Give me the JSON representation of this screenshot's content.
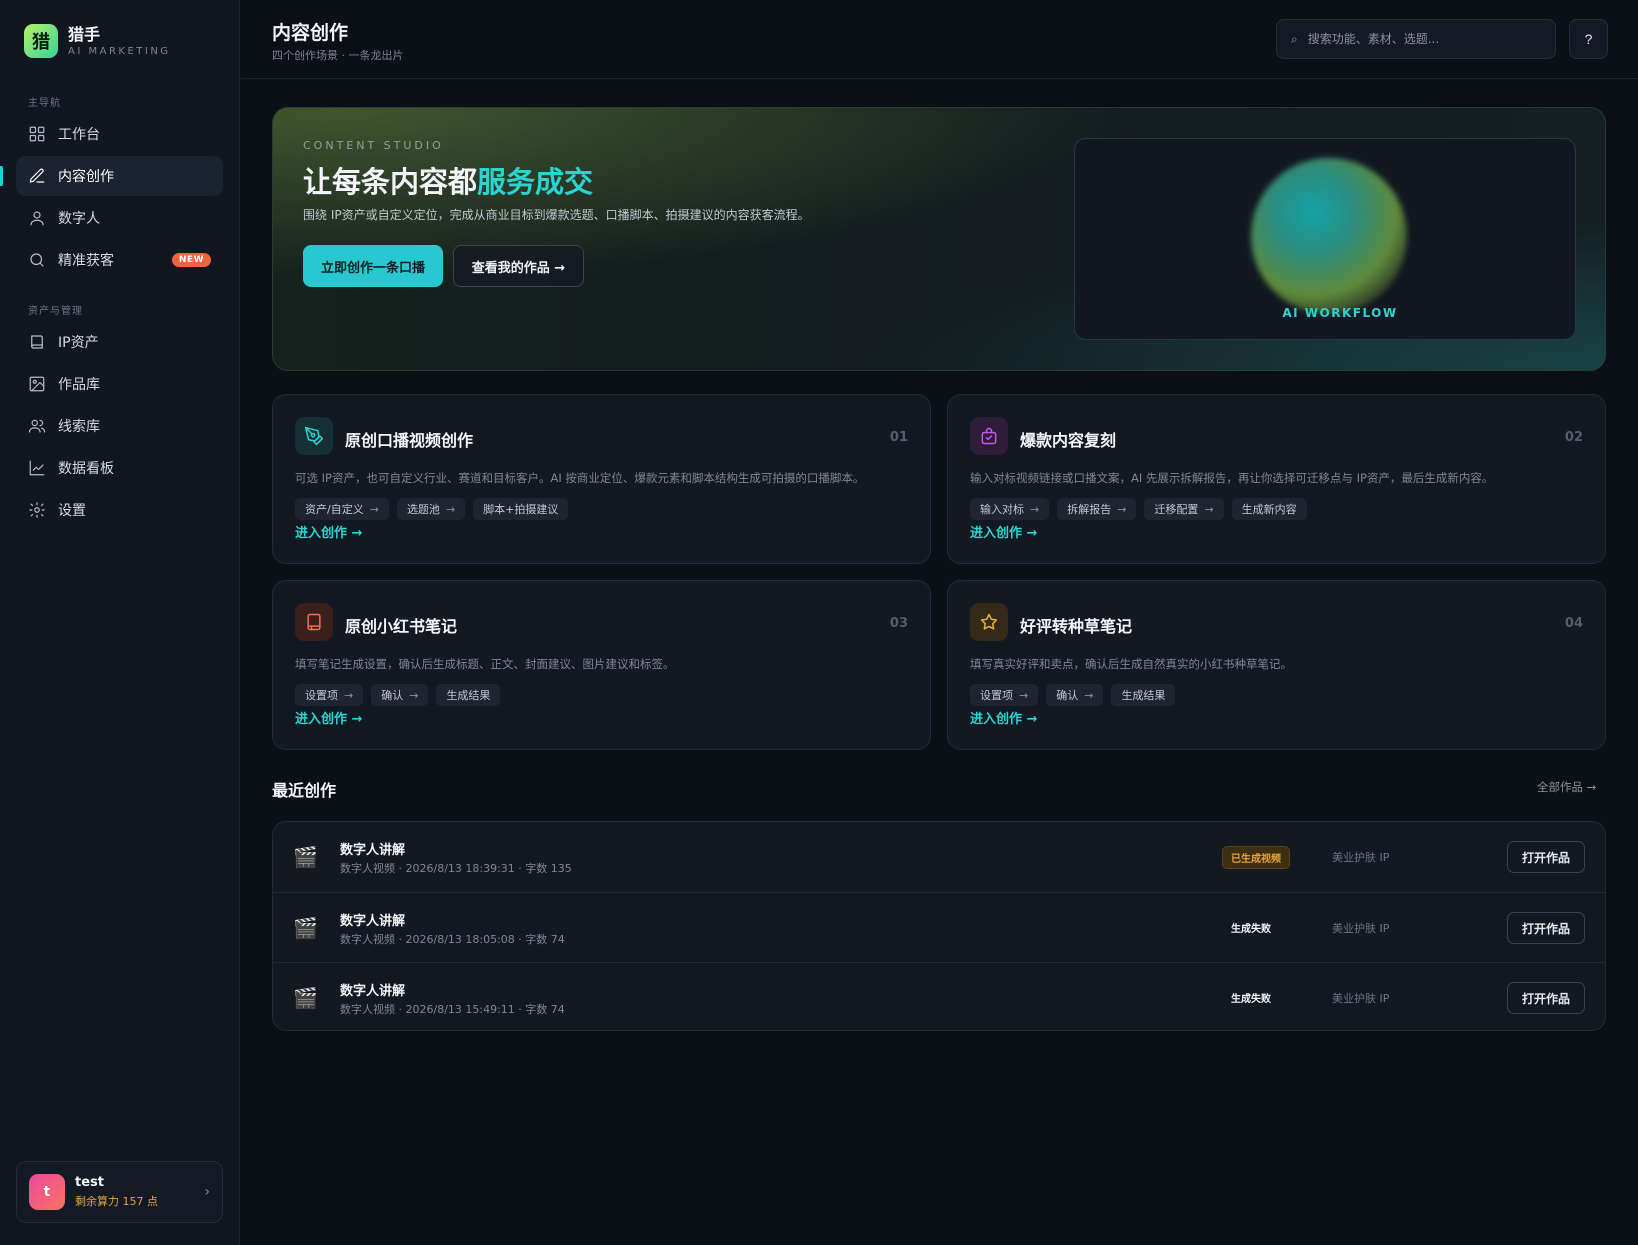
{
  "brand": {
    "logo_char": "猎",
    "name": "猎手",
    "subtitle": "AI MARKETING"
  },
  "sidebar": {
    "section_main": "主导航",
    "section_assets": "资产与管理",
    "items": [
      {
        "label": "工作台",
        "icon": "grid-icon"
      },
      {
        "label": "内容创作",
        "icon": "pencil-icon",
        "active": true
      },
      {
        "label": "数字人",
        "icon": "user-icon"
      },
      {
        "label": "精准获客",
        "icon": "search-icon",
        "badge": "NEW"
      },
      {
        "label": "IP资产",
        "icon": "book-icon"
      },
      {
        "label": "作品库",
        "icon": "image-icon"
      },
      {
        "label": "线索库",
        "icon": "users-icon"
      },
      {
        "label": "数据看板",
        "icon": "chart-icon"
      },
      {
        "label": "设置",
        "icon": "gear-icon"
      }
    ],
    "user": {
      "avatar": "t",
      "name": "test",
      "points": "剩余算力 157 点"
    }
  },
  "header": {
    "title": "内容创作",
    "subtitle": "四个创作场景 · 一条龙出片",
    "search_placeholder": "搜索功能、素材、选题...",
    "help": "?"
  },
  "hero": {
    "eyebrow": "CONTENT STUDIO",
    "title_prefix": "让每条内容都",
    "title_accent": "服务成交",
    "description": "围绕 IP资产或自定义定位，完成从商业目标到爆款选题、口播脚本、拍摄建议的内容获客流程。",
    "primary_button": "立即创作一条口播",
    "secondary_button": "查看我的作品 →",
    "visual_label": "AI WORKFLOW"
  },
  "cards": [
    {
      "title": "原创口播视频创作",
      "num": "01",
      "desc": "可选 IP资产，也可自定义行业、赛道和目标客户。AI 按商业定位、爆款元素和脚本结构生成可拍摄的口播脚本。",
      "chips": [
        "资产/自定义",
        "选题池",
        "脚本+拍摄建议"
      ],
      "link": "进入创作 →",
      "icon": "pen-tool-icon",
      "color": "#2bd4d0"
    },
    {
      "title": "爆款内容复刻",
      "num": "02",
      "desc": "输入对标视频链接或口播文案，AI 先展示拆解报告，再让你选择可迁移点与 IP资产，最后生成新内容。",
      "chips": [
        "输入对标",
        "拆解报告",
        "迁移配置",
        "生成新内容"
      ],
      "link": "进入创作 →",
      "icon": "shopping-bag-icon",
      "color": "#c15ae6"
    },
    {
      "title": "原创小红书笔记",
      "num": "03",
      "desc": "填写笔记生成设置，确认后生成标题、正文、封面建议、图片建议和标签。",
      "chips": [
        "设置项",
        "确认",
        "生成结果"
      ],
      "link": "进入创作 →",
      "icon": "notebook-icon",
      "color": "#f07050"
    },
    {
      "title": "好评转种草笔记",
      "num": "04",
      "desc": "填写真实好评和卖点，确认后生成自然真实的小红书种草笔记。",
      "chips": [
        "设置项",
        "确认",
        "生成结果"
      ],
      "link": "进入创作 →",
      "icon": "star-icon",
      "color": "#e8b03a"
    }
  ],
  "recent": {
    "title": "最近创作",
    "view_all": "全部作品 →",
    "rows": [
      {
        "icon": "🎬",
        "title": "数字人讲解",
        "meta": "数字人视频 · 2026/8/13 18:39:31 · 字数 135",
        "status": "已生成视频",
        "status_type": "ok",
        "ip": "美业护肤 IP",
        "action": "打开作品"
      },
      {
        "icon": "🎬",
        "title": "数字人讲解",
        "meta": "数字人视频 · 2026/8/13 18:05:08 · 字数 74",
        "status": "生成失败",
        "status_type": "fail",
        "ip": "美业护肤 IP",
        "action": "打开作品"
      },
      {
        "icon": "🎬",
        "title": "数字人讲解",
        "meta": "数字人视频 · 2026/8/13 15:49:11 · 字数 74",
        "status": "生成失败",
        "status_type": "fail",
        "ip": "美业护肤 IP",
        "action": "打开作品"
      }
    ]
  }
}
